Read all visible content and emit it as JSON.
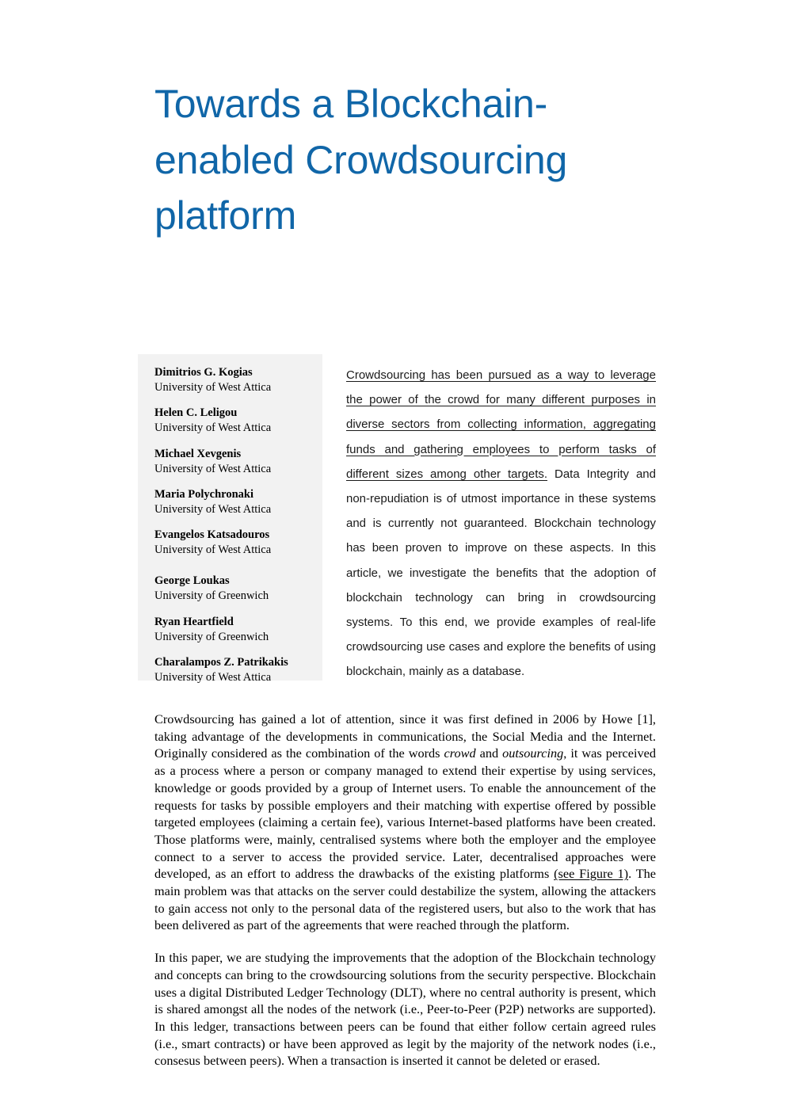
{
  "document": {
    "title": "Towards a Blockchain-enabled Crowdsourcing platform",
    "title_color": "#1066A8",
    "authors_panel_bg": "#f2f2f2"
  },
  "authors": [
    {
      "name": "Dimitrios G. Kogias",
      "affiliation": "University of West Attica",
      "extra_space_before": false
    },
    {
      "name": "Helen C. Leligou",
      "affiliation": "University of West Attica",
      "extra_space_before": false
    },
    {
      "name": "Michael Xevgenis",
      "affiliation": "University of West Attica",
      "extra_space_before": false
    },
    {
      "name": "Maria Polychronaki",
      "affiliation": "University of West Attica",
      "extra_space_before": false
    },
    {
      "name": "Evangelos Katsadouros",
      "affiliation": "University of West Attica",
      "extra_space_before": false
    },
    {
      "name": "George Loukas",
      "affiliation": "University of Greenwich",
      "extra_space_before": true
    },
    {
      "name": "Ryan Heartfield",
      "affiliation": "University of Greenwich",
      "extra_space_before": false
    },
    {
      "name": "Charalampos Z. Patrikakis",
      "affiliation": "University of West Attica",
      "extra_space_before": false
    }
  ],
  "abstract": {
    "underlined_part": "Crowdsourcing has been pursued as a way to leverage the power of the crowd for many different purposes in diverse sectors from collecting information, aggregating funds and gathering employees to perform tasks of different sizes among other targets.",
    "rest": " Data Integrity and non-repudiation is of utmost importance in these systems and is currently not guaranteed. Blockchain technology has been proven to improve on these aspects. In this article, we investigate the benefits that the adoption of blockchain technology can bring in crowdsourcing systems. To this end, we provide examples of real-life crowdsourcing use cases and explore the benefits of using blockchain, mainly as a database."
  },
  "body": {
    "paragraph1": {
      "part1": "Crowdsourcing has gained a lot of attention, since it was first defined in 2006 by Howe [1], taking advantage of the developments in communications, the Social Media and the Internet. Originally considered as the combination of the words ",
      "italic1": "crowd",
      "part2": " and ",
      "italic2": "outsourcing",
      "part3": ", it was perceived as a process where a person or company managed to extend their expertise by using services, knowledge or goods provided by a group of Internet users. To enable the announcement of the requests for tasks by possible employers and their matching with expertise offered by possible targeted employees (claiming a certain fee), various Internet-based platforms have been created. Those platforms were, mainly, centralised systems where both the employer and the employee connect to a server to access the provided service. Later, decentralised approaches were developed, as an effort to address the drawbacks of the existing platforms ",
      "xref": "(see Figure 1)",
      "part4": ". The main problem was that attacks on the server could destabilize the system, allowing the attackers to gain access not only to the personal data of the registered users, but also to the work that has been delivered as part of the agreements that were reached through the platform."
    },
    "paragraph2": {
      "text": "In this paper, we are studying the improvements that the adoption of the Blockchain technology and concepts can bring to the crowdsourcing solutions from the security perspective. Blockchain uses a digital Distributed Ledger Technology (DLT), where no central authority is present, which is shared amongst all the nodes of the network (i.e., Peer-to-Peer (P2P) networks are supported). In this ledger, transactions between peers can be found that either follow certain agreed rules (i.e., smart contracts) or have been approved as legit by the majority of the network nodes (i.e., consesus between peers). When a transaction is inserted it cannot be deleted or erased."
    }
  }
}
